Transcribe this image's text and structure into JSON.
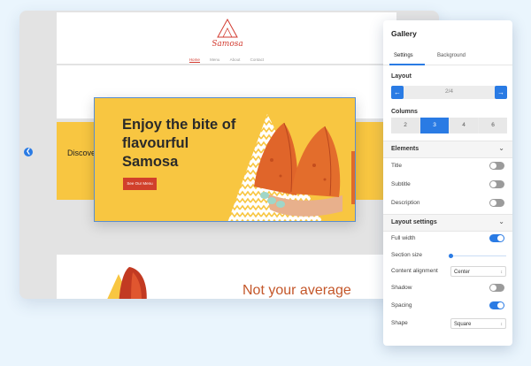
{
  "site": {
    "logo_text": "Samosa",
    "nav": [
      "Home",
      "Menu",
      "About",
      "Contact"
    ],
    "strip_text": "Discove",
    "section_heading": "Not your average"
  },
  "slide": {
    "title": "Enjoy the bite of flavourful Samosa",
    "button_label": "See Our Menu"
  },
  "panel": {
    "title": "Gallery",
    "tabs": {
      "settings": "Settings",
      "background": "Background"
    },
    "layout": {
      "label": "Layout",
      "prev_icon": "arrow-left-icon",
      "next_icon": "arrow-right-icon",
      "value": "2/4"
    },
    "columns": {
      "label": "Columns",
      "options": [
        "2",
        "3",
        "4",
        "6"
      ],
      "selected": "3"
    },
    "elements": {
      "heading": "Elements",
      "title": {
        "label": "Title",
        "on": false
      },
      "subtitle": {
        "label": "Subtitle",
        "on": false
      },
      "description": {
        "label": "Description",
        "on": false
      }
    },
    "layout_settings": {
      "heading": "Layout settings",
      "full_width": {
        "label": "Full width",
        "on": true
      },
      "section_size": {
        "label": "Section size",
        "value": 0
      },
      "content_alignment": {
        "label": "Content alignment",
        "value": "Center"
      },
      "shadow": {
        "label": "Shadow",
        "on": false
      },
      "spacing": {
        "label": "Spacing",
        "on": true
      },
      "shape": {
        "label": "Shape",
        "value": "Square"
      }
    }
  },
  "colors": {
    "accent": "#2a7be4",
    "slide_bg": "#f8c641",
    "brand_red": "#d1402b"
  }
}
